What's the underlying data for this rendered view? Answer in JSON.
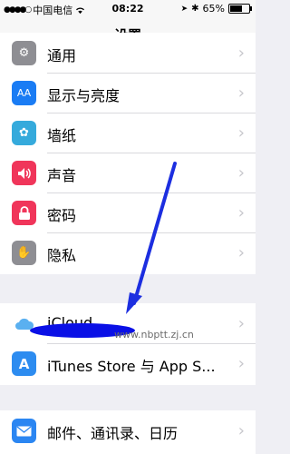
{
  "status": {
    "carrier": "中国电信",
    "time": "08:22",
    "battery": "65%",
    "battery_level": 0.65
  },
  "nav": {
    "title": "设置"
  },
  "rows": [
    {
      "label": "通用",
      "icon": "gear-icon",
      "color": "#8e8e93"
    },
    {
      "label": "显示与亮度",
      "icon": "aa-display-icon",
      "color": "#1a7cf4"
    },
    {
      "label": "墙纸",
      "icon": "flower-wallpaper-icon",
      "color": "#35aadc"
    },
    {
      "label": "声音",
      "icon": "speaker-icon",
      "color": "#f0355a"
    },
    {
      "label": "密码",
      "icon": "lock-icon",
      "color": "#f0355a"
    },
    {
      "label": "隐私",
      "icon": "hand-icon",
      "color": "#8e8e93"
    },
    {
      "label": "iCloud",
      "icon": "cloud-icon",
      "color": "#ffffff"
    },
    {
      "label": "iTunes Store 与 App S...",
      "icon": "app-store-icon",
      "color": "#2d8cf0"
    },
    {
      "label": "邮件、通讯录、日历",
      "icon": "mail-icon",
      "color": "#2b86f2"
    }
  ],
  "watermark": "www.nbptt.zj.cn",
  "annotation": {
    "arrow_color": "#1c2ee0"
  }
}
